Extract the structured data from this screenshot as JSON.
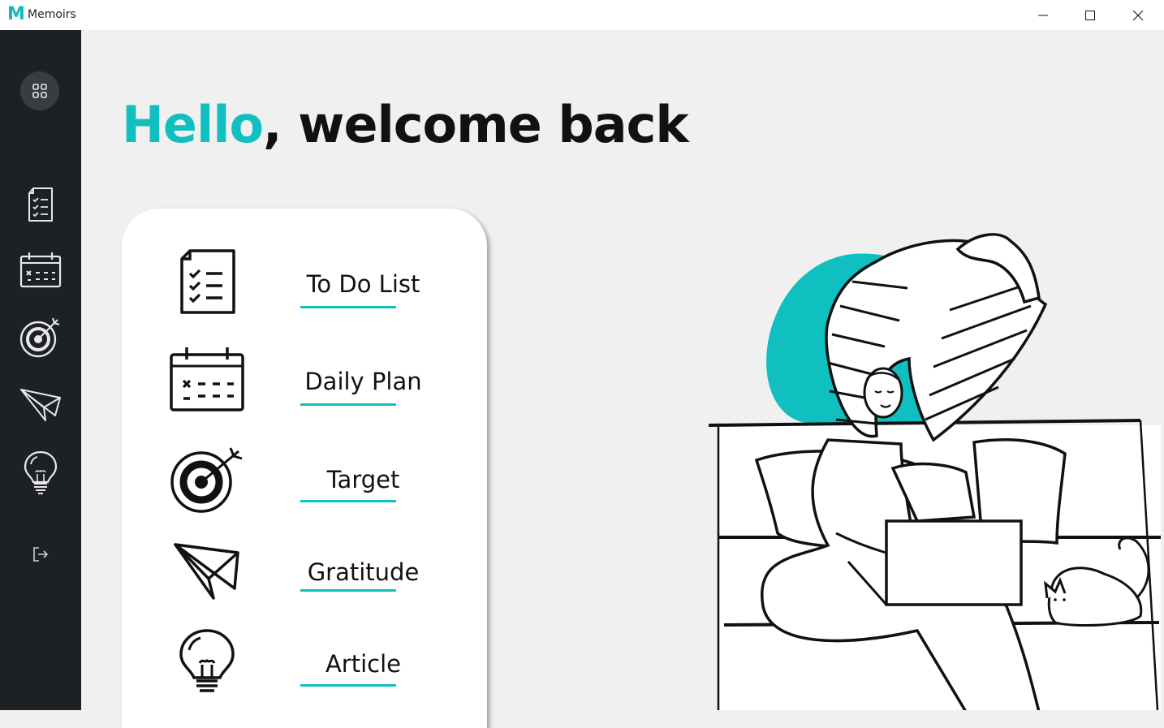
{
  "app": {
    "logo": "M",
    "title": "Memoirs"
  },
  "window_controls": [
    "minimize-icon",
    "maximize-icon",
    "close-icon"
  ],
  "sidebar": {
    "items": [
      {
        "name": "home",
        "icon": "grid-icon"
      },
      {
        "name": "todo",
        "icon": "checklist-icon"
      },
      {
        "name": "daily-plan",
        "icon": "calendar-icon"
      },
      {
        "name": "target",
        "icon": "target-icon"
      },
      {
        "name": "gratitude",
        "icon": "paper-plane-icon"
      },
      {
        "name": "article",
        "icon": "lightbulb-icon"
      },
      {
        "name": "logout",
        "icon": "logout-icon"
      }
    ]
  },
  "greeting": {
    "accent": "Hello",
    "rest": ", welcome back"
  },
  "menu": {
    "items": [
      {
        "label": "To Do List",
        "icon": "checklist-icon"
      },
      {
        "label": "Daily Plan",
        "icon": "calendar-icon"
      },
      {
        "label": "Target",
        "icon": "target-icon"
      },
      {
        "label": "Gratitude",
        "icon": "paper-plane-icon"
      },
      {
        "label": "Article",
        "icon": "lightbulb-icon"
      }
    ]
  },
  "colors": {
    "accent": "#10bfbf",
    "sidebar": "#1d2025",
    "background": "#f0f0f0"
  }
}
